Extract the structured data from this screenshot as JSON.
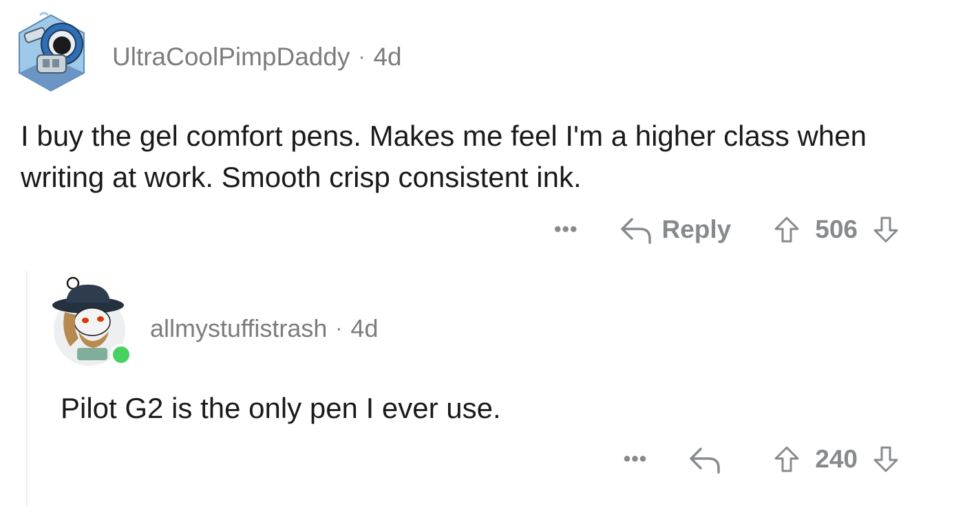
{
  "comments": [
    {
      "username": "UltraCoolPimpDaddy",
      "separator": "·",
      "age": "4d",
      "body": "I buy the gel comfort pens. Makes me feel I'm a higher class when writing at work. Smooth crisp consistent ink.",
      "more_label": "•••",
      "reply_label": "Reply",
      "score": "506",
      "avatar_icon": "robot-avatar-icon"
    },
    {
      "username": "allmystuffistrash",
      "separator": "·",
      "age": "4d",
      "body": "Pilot G2 is the only pen I ever use.",
      "more_label": "•••",
      "score": "240",
      "avatar_icon": "cowboy-avatar-icon",
      "online_status_color": "#46d160"
    }
  ],
  "colors": {
    "meta_text": "#7c7c7c",
    "action_text": "#878a8c",
    "body_text": "#1a1a1b",
    "thread_line": "#edeff1"
  }
}
